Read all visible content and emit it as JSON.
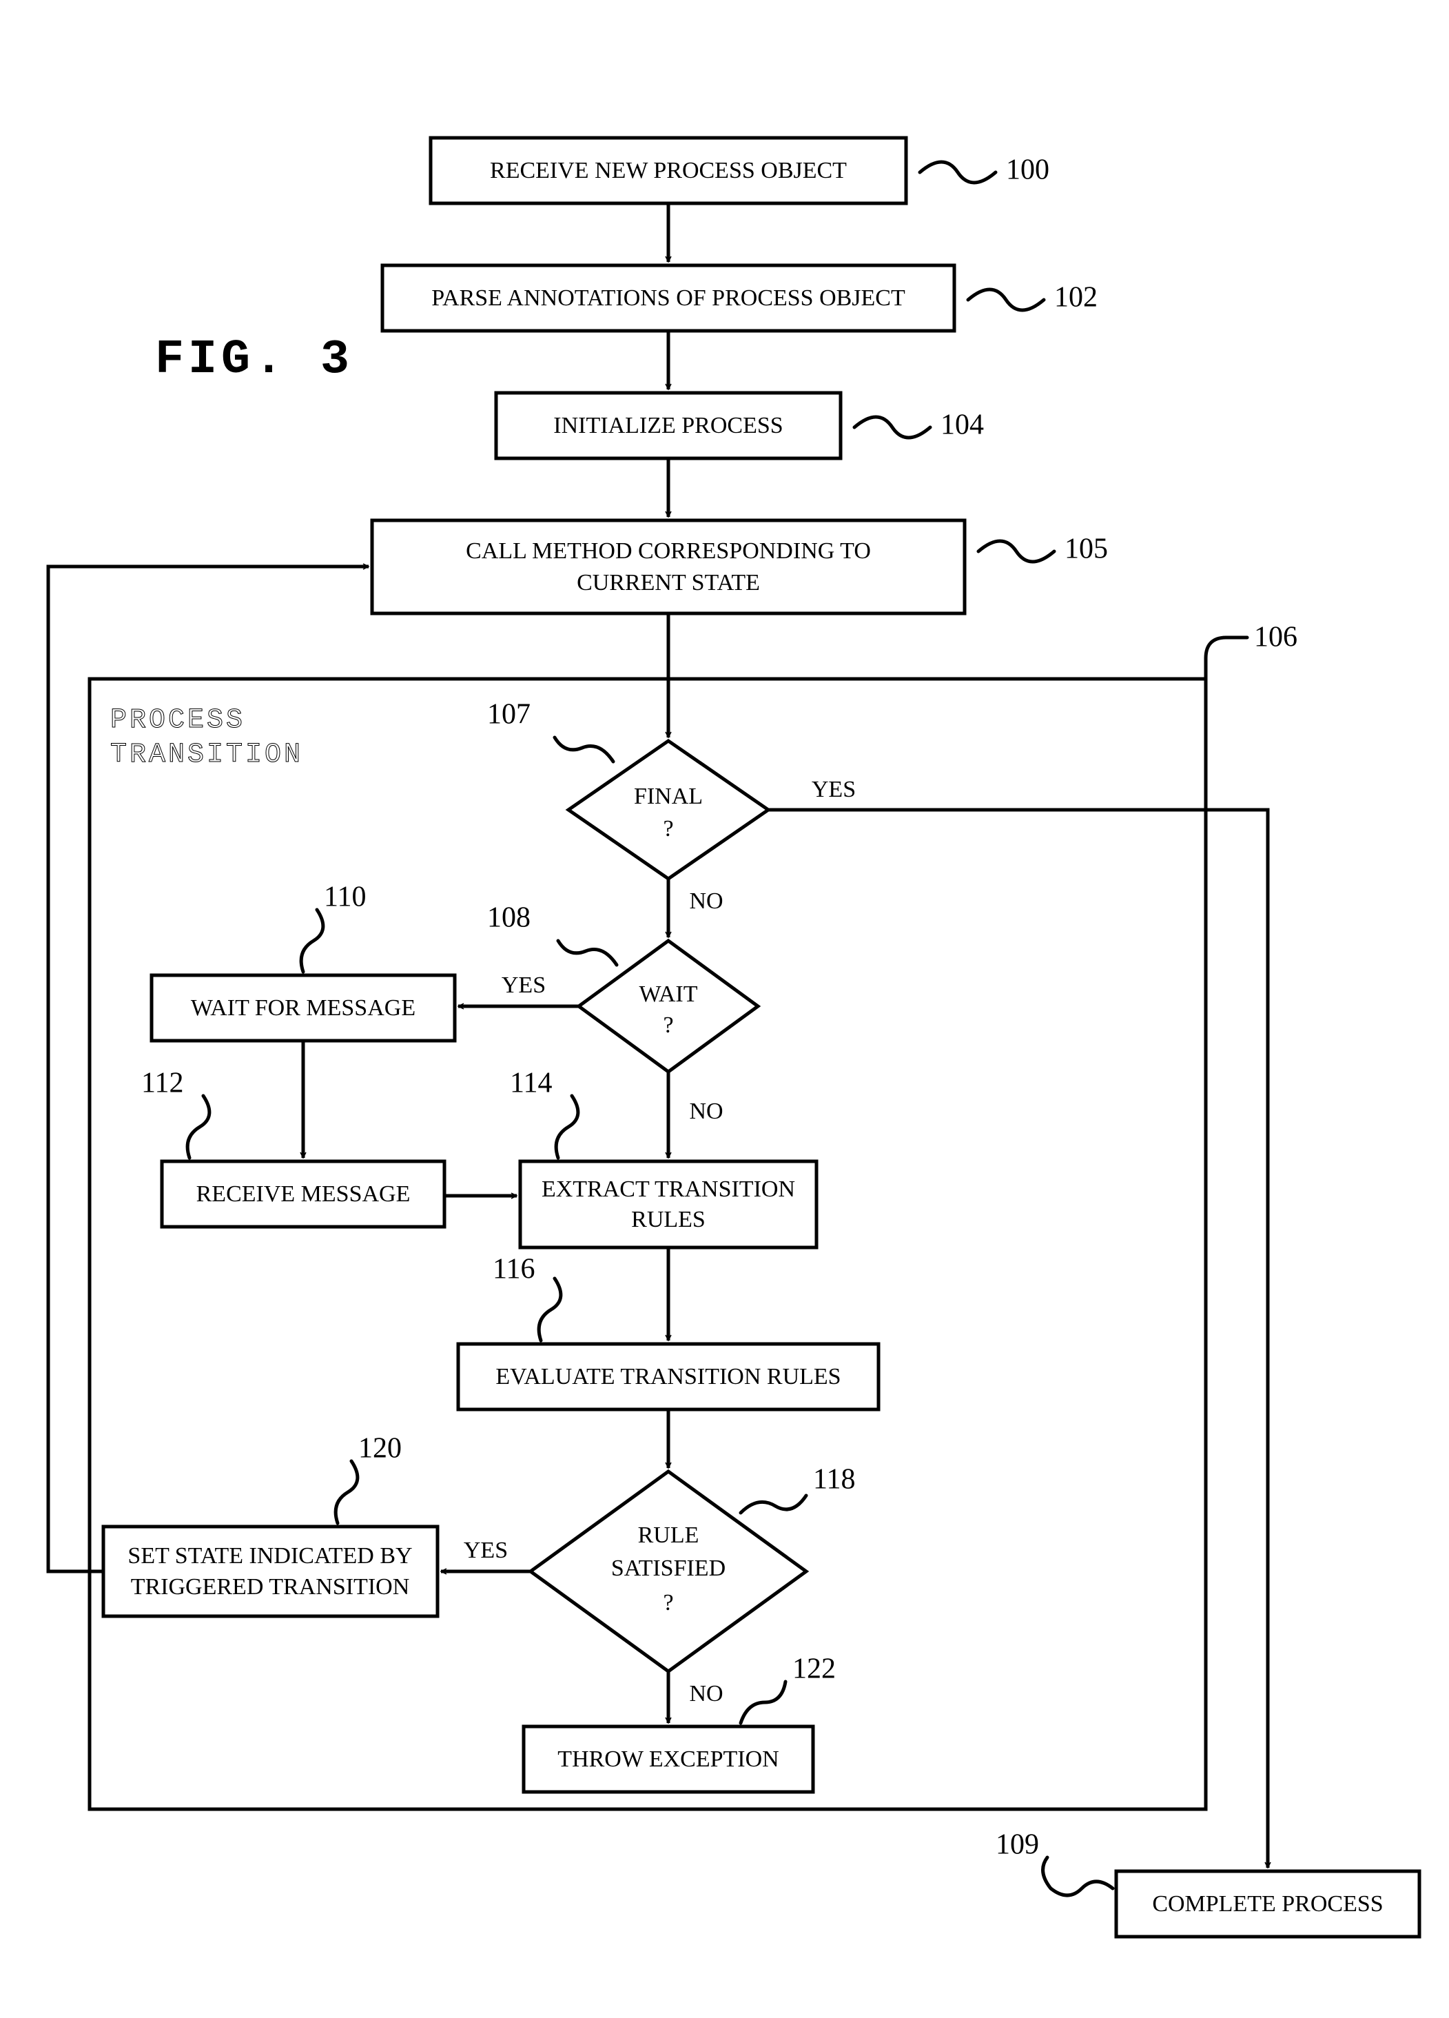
{
  "figure_label": "FIG.  3",
  "container_label_line1": "PROCESS",
  "container_label_line2": "TRANSITION",
  "nodes": {
    "n100": {
      "text": "RECEIVE NEW PROCESS OBJECT",
      "ref": "100"
    },
    "n102": {
      "text": "PARSE ANNOTATIONS OF PROCESS OBJECT",
      "ref": "102"
    },
    "n104": {
      "text": "INITIALIZE PROCESS",
      "ref": "104"
    },
    "n105": {
      "line1": "CALL METHOD CORRESPONDING TO",
      "line2": "CURRENT STATE",
      "ref": "105"
    },
    "n106": {
      "ref": "106"
    },
    "n107": {
      "line1": "FINAL",
      "line2": "?",
      "ref": "107"
    },
    "n108": {
      "line1": "WAIT",
      "line2": "?",
      "ref": "108"
    },
    "n109": {
      "text": "COMPLETE PROCESS",
      "ref": "109"
    },
    "n110": {
      "text": "WAIT FOR MESSAGE",
      "ref": "110"
    },
    "n112": {
      "text": "RECEIVE MESSAGE",
      "ref": "112"
    },
    "n114": {
      "line1": "EXTRACT TRANSITION",
      "line2": "RULES",
      "ref": "114"
    },
    "n116": {
      "text": "EVALUATE TRANSITION RULES",
      "ref": "116"
    },
    "n118": {
      "line1": "RULE",
      "line2": "SATISFIED",
      "line3": "?",
      "ref": "118"
    },
    "n120": {
      "line1": "SET STATE INDICATED BY",
      "line2": "TRIGGERED TRANSITION",
      "ref": "120"
    },
    "n122": {
      "text": "THROW EXCEPTION",
      "ref": "122"
    }
  },
  "edge_labels": {
    "final_yes": "YES",
    "final_no": "NO",
    "wait_yes": "YES",
    "wait_no": "NO",
    "rule_yes": "YES",
    "rule_no": "NO"
  },
  "chart_data": {
    "type": "flowchart",
    "title": "FIG. 3",
    "container": {
      "id": "106",
      "label": "PROCESS TRANSITION",
      "contains": [
        "107",
        "108",
        "110",
        "112",
        "114",
        "116",
        "118",
        "120",
        "122"
      ]
    },
    "nodes": [
      {
        "id": "100",
        "shape": "process",
        "label": "RECEIVE NEW PROCESS OBJECT"
      },
      {
        "id": "102",
        "shape": "process",
        "label": "PARSE ANNOTATIONS OF PROCESS OBJECT"
      },
      {
        "id": "104",
        "shape": "process",
        "label": "INITIALIZE PROCESS"
      },
      {
        "id": "105",
        "shape": "process",
        "label": "CALL METHOD CORRESPONDING TO CURRENT STATE"
      },
      {
        "id": "107",
        "shape": "decision",
        "label": "FINAL ?"
      },
      {
        "id": "108",
        "shape": "decision",
        "label": "WAIT ?"
      },
      {
        "id": "109",
        "shape": "process",
        "label": "COMPLETE PROCESS"
      },
      {
        "id": "110",
        "shape": "process",
        "label": "WAIT FOR MESSAGE"
      },
      {
        "id": "112",
        "shape": "process",
        "label": "RECEIVE MESSAGE"
      },
      {
        "id": "114",
        "shape": "process",
        "label": "EXTRACT TRANSITION RULES"
      },
      {
        "id": "116",
        "shape": "process",
        "label": "EVALUATE TRANSITION RULES"
      },
      {
        "id": "118",
        "shape": "decision",
        "label": "RULE SATISFIED ?"
      },
      {
        "id": "120",
        "shape": "process",
        "label": "SET STATE INDICATED BY TRIGGERED TRANSITION"
      },
      {
        "id": "122",
        "shape": "process",
        "label": "THROW EXCEPTION"
      }
    ],
    "edges": [
      {
        "from": "100",
        "to": "102"
      },
      {
        "from": "102",
        "to": "104"
      },
      {
        "from": "104",
        "to": "105"
      },
      {
        "from": "105",
        "to": "107"
      },
      {
        "from": "107",
        "to": "109",
        "label": "YES"
      },
      {
        "from": "107",
        "to": "108",
        "label": "NO"
      },
      {
        "from": "108",
        "to": "110",
        "label": "YES"
      },
      {
        "from": "108",
        "to": "114",
        "label": "NO"
      },
      {
        "from": "110",
        "to": "112"
      },
      {
        "from": "112",
        "to": "114"
      },
      {
        "from": "114",
        "to": "116"
      },
      {
        "from": "116",
        "to": "118"
      },
      {
        "from": "118",
        "to": "120",
        "label": "YES"
      },
      {
        "from": "118",
        "to": "122",
        "label": "NO"
      },
      {
        "from": "120",
        "to": "105"
      }
    ]
  }
}
